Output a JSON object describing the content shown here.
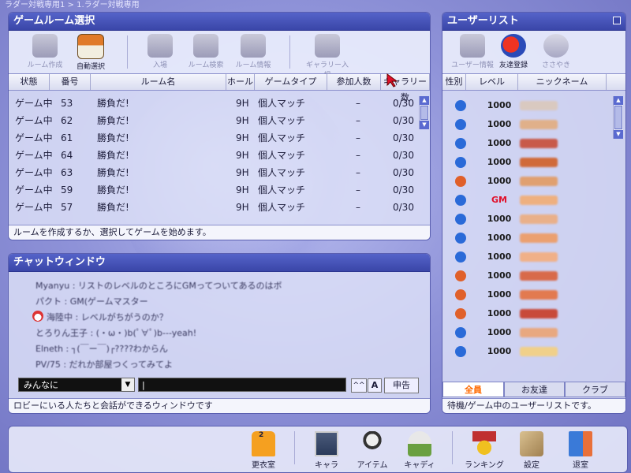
{
  "window_title": "ラダー対戦専用1 > 1.ラダー対戦専用",
  "room_panel": {
    "title": "ゲームルーム選択",
    "toolbar": [
      {
        "label": "ルーム作成",
        "enabled": false
      },
      {
        "label": "自動選択",
        "enabled": true
      },
      {
        "label": "入場",
        "enabled": false
      },
      {
        "label": "ルーム検索",
        "enabled": false
      },
      {
        "label": "ルーム情報",
        "enabled": false
      },
      {
        "label": "ギャラリー入場",
        "enabled": false
      }
    ],
    "columns": [
      "状態",
      "番号",
      "ルーム名",
      "ホール",
      "ゲームタイプ",
      "参加人数",
      "ギャラリー数"
    ],
    "rows": [
      {
        "state": "ゲーム中",
        "no": "53",
        "name": "勝負だ!",
        "hole": "9H",
        "type": "個人マッチ",
        "players": "–",
        "gallery": "0/30"
      },
      {
        "state": "ゲーム中",
        "no": "62",
        "name": "勝負だ!",
        "hole": "9H",
        "type": "個人マッチ",
        "players": "–",
        "gallery": "0/30"
      },
      {
        "state": "ゲーム中",
        "no": "61",
        "name": "勝負だ!",
        "hole": "9H",
        "type": "個人マッチ",
        "players": "–",
        "gallery": "0/30"
      },
      {
        "state": "ゲーム中",
        "no": "64",
        "name": "勝負だ!",
        "hole": "9H",
        "type": "個人マッチ",
        "players": "–",
        "gallery": "0/30"
      },
      {
        "state": "ゲーム中",
        "no": "63",
        "name": "勝負だ!",
        "hole": "9H",
        "type": "個人マッチ",
        "players": "–",
        "gallery": "0/30"
      },
      {
        "state": "ゲーム中",
        "no": "59",
        "name": "勝負だ!",
        "hole": "9H",
        "type": "個人マッチ",
        "players": "–",
        "gallery": "0/30"
      },
      {
        "state": "ゲーム中",
        "no": "57",
        "name": "勝負だ!",
        "hole": "9H",
        "type": "個人マッチ",
        "players": "–",
        "gallery": "0/30"
      }
    ],
    "status": "ルームを作成するか、選択してゲームを始めます。"
  },
  "chat_panel": {
    "title": "チャットウィンドウ",
    "messages": [
      "Myanyu : リストのレベルのところにGMってついてあるのはボ",
      "パクト : GM(ゲームマスター",
      "海陸中 : レベルがちがうのか？",
      "とろりん王子 : (・ω・)b(ﾟ∀ﾟ)b---yeah!",
      "Elneth : ┐(￣ー￣)┌????わからん",
      "PV/75 : だれか部屋つくってみてよ"
    ],
    "channel": "みんなに",
    "input_value": "|",
    "font_up_label": "^^",
    "font_label": "A",
    "report_label": "申告",
    "status": "ロビーにいる人たちと会話ができるウィンドウです"
  },
  "user_panel": {
    "title": "ユーザーリスト",
    "toolbar": [
      {
        "label": "ユーザー情報",
        "enabled": false
      },
      {
        "label": "友達登録",
        "enabled": true
      },
      {
        "label": "ささやき",
        "enabled": false
      }
    ],
    "columns": [
      "性別",
      "レベル",
      "ニックネーム"
    ],
    "users": [
      {
        "gender": "male",
        "level": "1000"
      },
      {
        "gender": "male",
        "level": "1000"
      },
      {
        "gender": "male",
        "level": "1000"
      },
      {
        "gender": "male",
        "level": "1000"
      },
      {
        "gender": "female",
        "level": "1000"
      },
      {
        "gender": "male",
        "level": "GM"
      },
      {
        "gender": "male",
        "level": "1000"
      },
      {
        "gender": "male",
        "level": "1000"
      },
      {
        "gender": "male",
        "level": "1000"
      },
      {
        "gender": "female",
        "level": "1000"
      },
      {
        "gender": "female",
        "level": "1000"
      },
      {
        "gender": "female",
        "level": "1000"
      },
      {
        "gender": "male",
        "level": "1000"
      },
      {
        "gender": "male",
        "level": "1000"
      }
    ],
    "tabs": [
      "全員",
      "お友達",
      "クラブ"
    ],
    "active_tab": "全員",
    "status": "待機/ゲーム中のユーザーリストです。"
  },
  "bottom_bar": {
    "changing_room_badge": "2",
    "buttons": [
      {
        "label": "更衣室",
        "icon": "shirt-icon"
      },
      {
        "label": "キャラ",
        "icon": "character-icon"
      },
      {
        "label": "アイテム",
        "icon": "golf-club-icon"
      },
      {
        "label": "キャディ",
        "icon": "caddie-icon"
      },
      {
        "label": "ランキング",
        "icon": "medal-icon"
      },
      {
        "label": "設定",
        "icon": "settings-icon"
      },
      {
        "label": "退室",
        "icon": "exit-door-icon"
      }
    ]
  },
  "colors": {
    "gm": "#e0102a",
    "male": "#2a6ad8",
    "female": "#e0602a",
    "active_tab": "#ff6a00"
  }
}
